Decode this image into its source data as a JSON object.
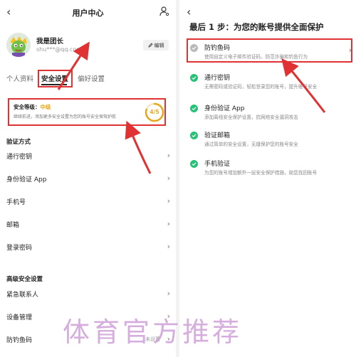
{
  "left": {
    "header": {
      "back": "‹",
      "title": "用户中心"
    },
    "profile": {
      "name": "我是团长",
      "email": "shu***@qq.com",
      "edit_label": "编辑"
    },
    "tabs": [
      {
        "label": "个人资料"
      },
      {
        "label": "安全设置"
      },
      {
        "label": "偏好设置"
      }
    ],
    "security": {
      "title_prefix": "安全等级：",
      "level": "中级",
      "desc": "继续前进，添加更多安全设置为您的账号安全保驾护航",
      "score": "4/5",
      "progress": 0.8
    },
    "verify_section": {
      "title": "验证方式",
      "items": [
        {
          "label": "通行密钥"
        },
        {
          "label": "身份验证 App"
        },
        {
          "label": "手机号"
        },
        {
          "label": "邮箱"
        },
        {
          "label": "登录密码"
        }
      ]
    },
    "advanced_section": {
      "title": "高级安全设置",
      "items": [
        {
          "label": "紧急联系人",
          "value": ""
        },
        {
          "label": "设备管理",
          "value": ""
        },
        {
          "label": "防钓鱼码",
          "value": "未设置"
        }
      ]
    }
  },
  "right": {
    "back": "‹",
    "title": "最后 1 步：为您的账号提供全面保护",
    "options": [
      {
        "title": "防钓鱼码",
        "desc": "使用自定义电子邮件验证码，防范诈骗和钓鱼行为",
        "status": "pending"
      },
      {
        "title": "通行密钥",
        "desc": "无需密码或验证码，轻松登录您的账号，提升账号安全",
        "status": "done"
      },
      {
        "title": "身份验证 App",
        "desc": "添加离线安全保护设置，抗网络安全漏洞攻击",
        "status": "done"
      },
      {
        "title": "验证邮箱",
        "desc": "通过简单的安全设置，无缝保护您的账号安全",
        "status": "done"
      },
      {
        "title": "手机验证",
        "desc": "为您的账号增加额外一层安全保护措施，助您找回账号",
        "status": "done"
      }
    ]
  },
  "icons": {
    "back": "chevron-left-icon",
    "user_settings": "user-gear-icon",
    "edit": "pencil-icon",
    "chevron": "chevron-right-icon",
    "check": "check-icon"
  },
  "colors": {
    "highlight_red": "#e03232",
    "level_orange": "#e6a817",
    "check_green": "#27c277",
    "watermark": "#cfa0d8"
  },
  "watermark": "体育官方推荐"
}
